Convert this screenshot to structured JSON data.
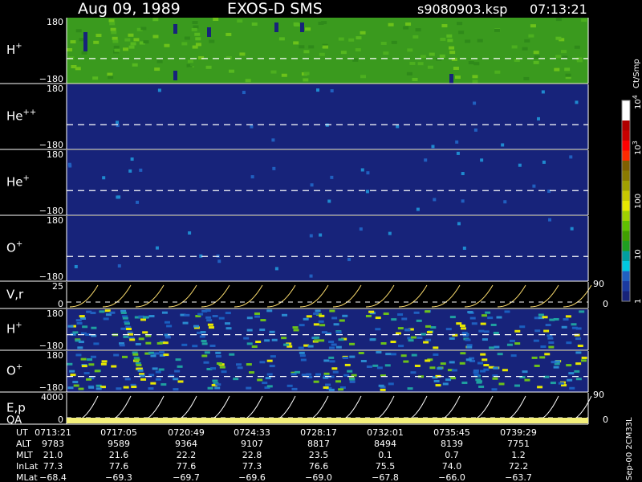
{
  "header": {
    "date": "Aug 09, 1989",
    "instrument": "EXOS-D SMS",
    "file": "s9080903.ksp",
    "time": "07:13:21"
  },
  "panels": [
    {
      "species": "H",
      "sup": "+",
      "ytop": "180",
      "ybot": "−180",
      "bg": "#3a9a1e"
    },
    {
      "species": "He",
      "sup": "++",
      "ytop": "180",
      "ybot": "−180",
      "bg": "#17237a"
    },
    {
      "species": "He",
      "sup": "+",
      "ytop": "180",
      "ybot": "−180",
      "bg": "#17237a"
    },
    {
      "species": "O",
      "sup": "+",
      "ytop": "180",
      "ybot": "−180",
      "bg": "#17237a"
    },
    {
      "species": "V,r",
      "sup": "",
      "ytop": "25",
      "ybot": "0",
      "rtop": "90",
      "rbot": "0"
    },
    {
      "species": "H",
      "sup": "+",
      "ytop": "180",
      "ybot": "−180",
      "bg": "#17237a"
    },
    {
      "species": "O",
      "sup": "+",
      "ytop": "180",
      "ybot": "−180",
      "bg": "#17237a"
    },
    {
      "species": "E,p",
      "sup": "",
      "ytop": "4000",
      "ybot": "0",
      "rtop": "90",
      "rbot": "0"
    }
  ],
  "qa_label": "QA",
  "colorbar": {
    "unit": "Ct/Smp",
    "ticks": [
      {
        "base": "10",
        "exp": "4"
      },
      {
        "base": "10",
        "exp": "3"
      },
      {
        "base": "100",
        "exp": ""
      },
      {
        "base": "10",
        "exp": ""
      },
      {
        "base": "1",
        "exp": ""
      }
    ],
    "colors": [
      "#ffffff",
      "#ffffff",
      "#b00000",
      "#c80000",
      "#ff0000",
      "#ff2a00",
      "#806000",
      "#8a7a00",
      "#a0a000",
      "#c8c800",
      "#e8e800",
      "#a0d000",
      "#60c000",
      "#40a000",
      "#1fa020",
      "#00a0a0",
      "#00c8e0",
      "#2060c0",
      "#1a3aa0",
      "#17237a"
    ]
  },
  "side_label": "Sep-00 2CM33L",
  "ephemeris": {
    "labels": [
      "UT",
      "ALT",
      "MLT",
      "InLat",
      "MLat"
    ],
    "columns": [
      [
        "0713:21",
        "9783",
        "21.0",
        "77.3",
        "−68.4"
      ],
      [
        "0717:05",
        "9589",
        "21.6",
        "77.6",
        "−69.3"
      ],
      [
        "0720:49",
        "9364",
        "22.2",
        "77.6",
        "−69.7"
      ],
      [
        "0724:33",
        "9107",
        "22.8",
        "77.3",
        "−69.6"
      ],
      [
        "0728:17",
        "8817",
        "23.5",
        "76.6",
        "−69.0"
      ],
      [
        "0732:01",
        "8494",
        "0.1",
        "75.5",
        "−67.8"
      ],
      [
        "0735:45",
        "8139",
        "0.7",
        "74.0",
        "−66.0"
      ],
      [
        "0739:29",
        "7751",
        "1.2",
        "72.2",
        "−63.7"
      ]
    ]
  }
}
